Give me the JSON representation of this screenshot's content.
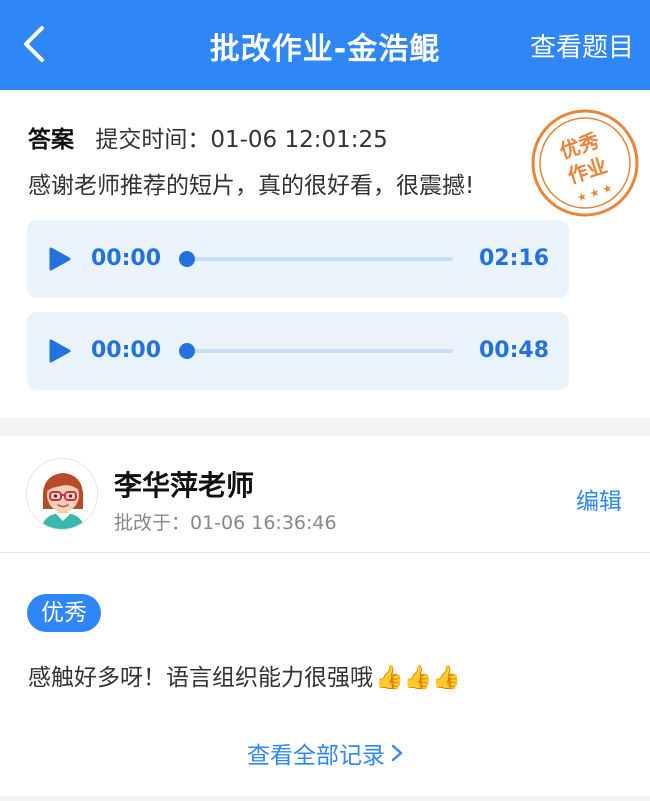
{
  "header": {
    "title": "批改作业-金浩鲲",
    "view_questions": "查看题目"
  },
  "answer": {
    "label": "答案",
    "submit_time": "提交时间：01-06 12:01:25",
    "text": "感谢老师推荐的短片，真的很好看，很震撼!",
    "audios": [
      {
        "current": "00:00",
        "duration": "02:16",
        "progress": 0
      },
      {
        "current": "00:00",
        "duration": "00:48",
        "progress": 0
      }
    ],
    "stamp": {
      "line1": "优秀",
      "line2": "作业",
      "stars": "★ ★ ★"
    }
  },
  "review": {
    "teacher_name": "李华萍老师",
    "review_time": "批改于：01-06 16:36:46",
    "edit_label": "编辑",
    "grade": "优秀",
    "comment": "感触好多呀！语言组织能力很强哦",
    "comment_emoji": "👍👍👍",
    "view_all": "查看全部记录"
  },
  "colors": {
    "brand": "#2f86f6",
    "audio_bg": "#eaf2fc",
    "audio_text": "#2372e0",
    "stamp": "#e8853a"
  }
}
